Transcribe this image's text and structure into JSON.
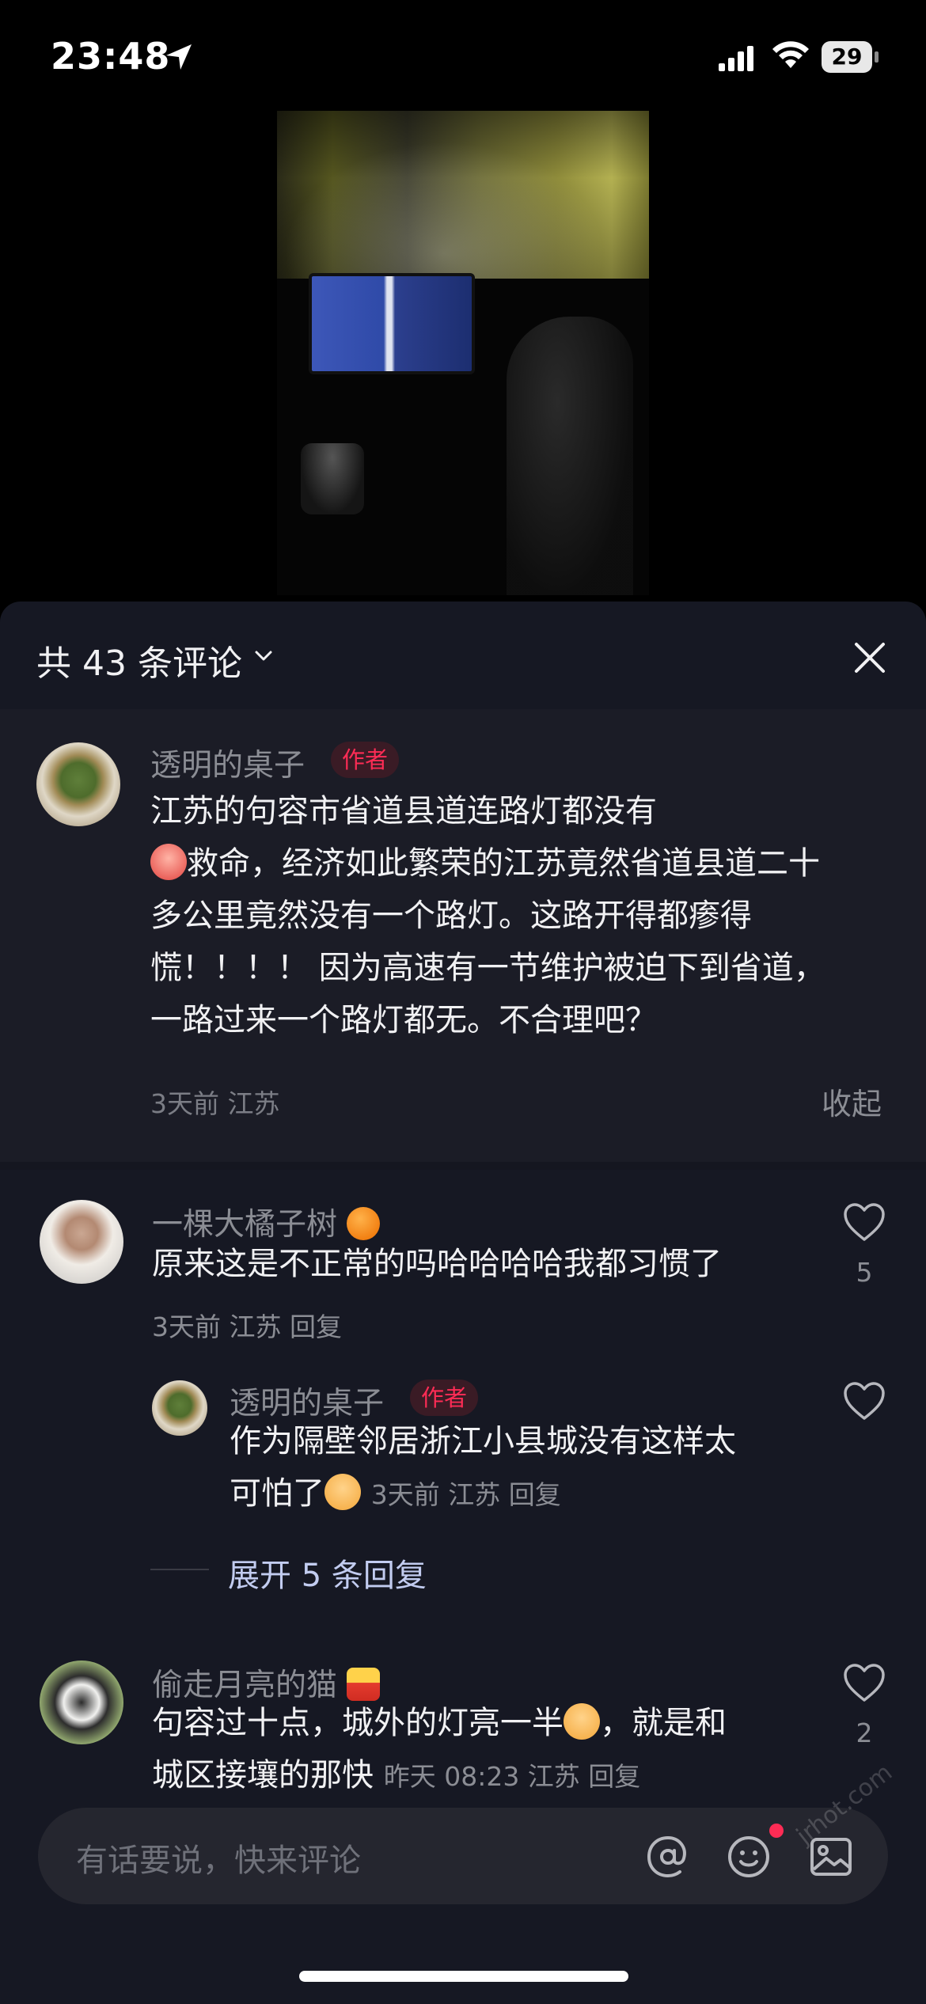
{
  "status_bar": {
    "time": "23:48",
    "battery": "29",
    "icons": [
      "location-arrow-icon",
      "cellular-signal-icon",
      "wifi-icon",
      "battery-icon"
    ]
  },
  "sheet": {
    "title": "共 43 条评论",
    "close_icon": "close-icon"
  },
  "author_post": {
    "username": "透明的桌子",
    "badge": "作者",
    "lines": [
      "江苏的句容市省道县道连路灯都没有",
      "救命，经济如此繁荣的江苏竟然省道县道二十",
      "多公里竟然没有一个路灯。这路开得都瘆得",
      "慌！！！！ 因为高速有一节维护被迫下到省道，",
      "一路过来一个路灯都无。不合理吧？"
    ],
    "meta": "3天前 江苏",
    "collapse_label": "收起"
  },
  "comments": [
    {
      "username": "一棵大橘子树",
      "text": "原来这是不正常的吗哈哈哈哈我都习惯了",
      "meta": "3天前 江苏 回复",
      "likes": "5",
      "reply": {
        "username": "透明的桌子",
        "badge": "作者",
        "line1": "作为隔壁邻居浙江小县城没有这样太",
        "line2": "可怕了",
        "meta": "3天前 江苏 回复"
      },
      "expand_label": "展开 5 条回复"
    },
    {
      "username": "偷走月亮的猫",
      "text": "句容过十点，城外的灯亮一半",
      "text_tail": "，就是和",
      "line2": "城区接壤的那快",
      "meta": "昨天 08:23 江苏 回复",
      "likes": "2"
    }
  ],
  "input_bar": {
    "placeholder": "有话要说，快来评论",
    "icons": [
      "at-icon",
      "emoji-icon",
      "image-icon"
    ]
  },
  "colors": {
    "accent": "#fe2c55",
    "sheet_bg": "#161823",
    "expand_link": "#c2ccf0"
  },
  "watermark": "jrhot.com"
}
